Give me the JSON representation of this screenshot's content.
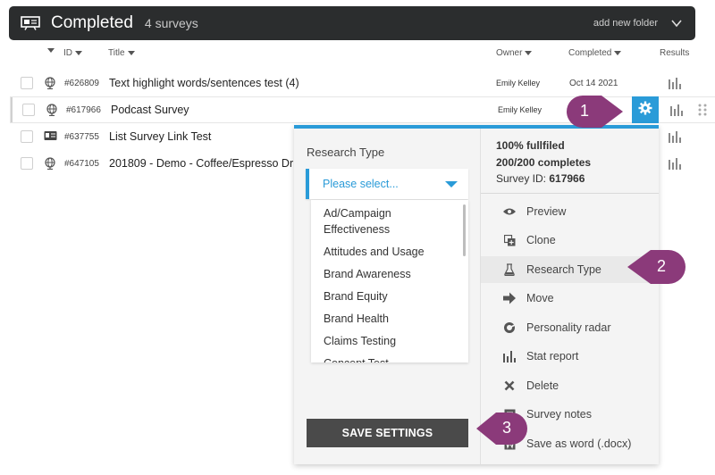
{
  "folder": {
    "title": "Completed",
    "count": "4 surveys",
    "add_folder": "add new folder"
  },
  "columns": {
    "id": "ID",
    "title": "Title",
    "owner": "Owner",
    "completed": "Completed",
    "results": "Results"
  },
  "rows": [
    {
      "id": "#626809",
      "title": "Text highlight words/sentences test (4)",
      "owner": "Emily Kelley",
      "date": "Oct 14 2021",
      "icon": "globe-icon"
    },
    {
      "id": "#617966",
      "title": "Podcast Survey",
      "owner": "Emily Kelley",
      "date": "",
      "icon": "globe-icon"
    },
    {
      "id": "#637755",
      "title": "List Survey Link Test",
      "owner": "",
      "date": "",
      "icon": "id-card-icon"
    },
    {
      "id": "#647105",
      "title": "201809 - Demo - Coffee/Espresso Dr",
      "owner": "",
      "date": "",
      "icon": "globe-icon"
    }
  ],
  "popup": {
    "research_type_label": "Research Type",
    "select_placeholder": "Please select...",
    "options": [
      "Ad/Campaign Effectiveness",
      "Attitudes and Usage",
      "Brand Awareness",
      "Brand Equity",
      "Brand Health",
      "Claims Testing",
      "Concept Test"
    ],
    "save_label": "SAVE SETTINGS",
    "info_fulfilled": "100% fullfiled",
    "info_completes": "200/200 completes",
    "info_survey_id_label": "Survey ID: ",
    "info_survey_id": "617966",
    "menu": [
      {
        "label": "Preview",
        "icon": "eye-icon"
      },
      {
        "label": "Clone",
        "icon": "clone-icon"
      },
      {
        "label": "Research Type",
        "icon": "flask-icon"
      },
      {
        "label": "Move",
        "icon": "arrow-right-icon"
      },
      {
        "label": "Personality radar",
        "icon": "radar-icon"
      },
      {
        "label": "Stat report",
        "icon": "bar-chart-icon"
      },
      {
        "label": "Delete",
        "icon": "x-icon"
      },
      {
        "label": "Survey notes",
        "icon": "notes-icon"
      },
      {
        "label": "Save as word (.docx)",
        "icon": "word-icon"
      }
    ]
  },
  "callouts": [
    "1",
    "2",
    "3"
  ],
  "colors": {
    "accent": "#2a9bd8",
    "callout": "#8b3a7a",
    "header_bg": "#2b2d2e"
  }
}
